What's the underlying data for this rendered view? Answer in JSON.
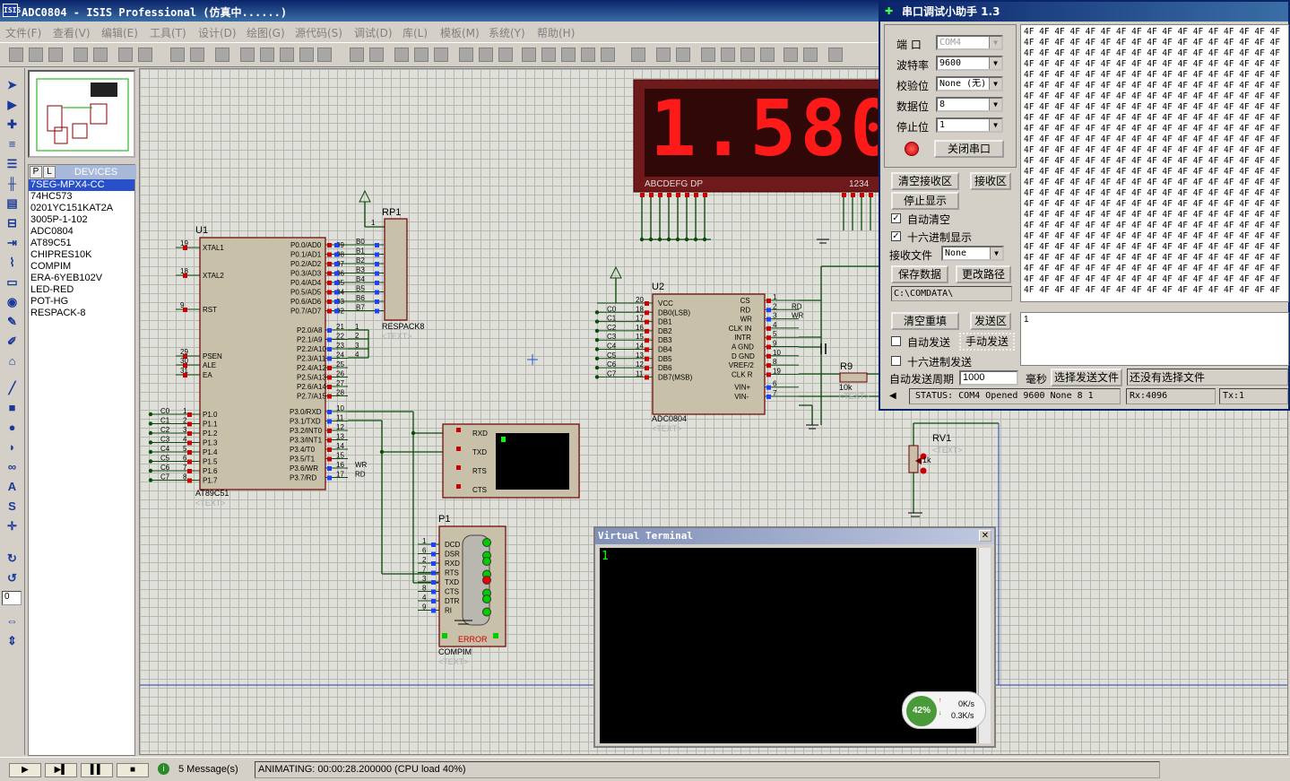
{
  "window": {
    "title": "ADC0804 - ISIS Professional (仿真中......)",
    "logo": "ISIS"
  },
  "menu": [
    "文件(F)",
    "查看(V)",
    "编辑(E)",
    "工具(T)",
    "设计(D)",
    "绘图(G)",
    "源代码(S)",
    "调试(D)",
    "库(L)",
    "模板(M)",
    "系统(Y)",
    "帮助(H)"
  ],
  "devices": {
    "tab_p": "P",
    "tab_l": "L",
    "header": "DEVICES",
    "items": [
      "7SEG-MPX4-CC",
      "74HC573",
      "0201YC151KAT2A",
      "3005P-1-102",
      "ADC0804",
      "AT89C51",
      "CHIPRES10K",
      "COMPIM",
      "ERA-6YEB102V",
      "LED-RED",
      "POT-HG",
      "RESPACK-8"
    ],
    "selected": "7SEG-MPX4-CC"
  },
  "rotation_value": "0",
  "schematic": {
    "u1": {
      "ref": "U1",
      "part": "AT89C51",
      "text": "<TEXT>"
    },
    "rp1": {
      "ref": "RP1",
      "part": "RESPACK8",
      "text": "<TEXT>"
    },
    "u2": {
      "ref": "U2",
      "part": "ADC0804",
      "text": "<TEXT>"
    },
    "p1": {
      "ref": "P1",
      "part": "COMPIM",
      "text": "<TEXT>",
      "error": "ERROR"
    },
    "r9": {
      "ref": "R9",
      "value": "10k",
      "text": "<TEXT>"
    },
    "rv1": {
      "ref": "RV1",
      "value": "1k",
      "text": "<TEXT>"
    },
    "display": {
      "digits": "1.580",
      "seg_label": "ABCDEFG  DP",
      "dig_label": "1234"
    },
    "u1_left_pins": [
      [
        "19",
        "XTAL1"
      ],
      [
        "18",
        "XTAL2"
      ],
      [
        "9",
        "RST"
      ],
      [
        "29",
        "PSEN"
      ],
      [
        "30",
        "ALE"
      ],
      [
        "31",
        "EA"
      ]
    ],
    "u1_port1": [
      [
        "1",
        "P1.0",
        "C0"
      ],
      [
        "2",
        "P1.1",
        "C1"
      ],
      [
        "3",
        "P1.2",
        "C2"
      ],
      [
        "4",
        "P1.3",
        "C3"
      ],
      [
        "5",
        "P1.4",
        "C4"
      ],
      [
        "6",
        "P1.5",
        "C5"
      ],
      [
        "7",
        "P1.6",
        "C6"
      ],
      [
        "8",
        "P1.7",
        "C7"
      ]
    ],
    "u1_port0": [
      [
        "39",
        "P0.0/AD0",
        "B0"
      ],
      [
        "38",
        "P0.1/AD1",
        "B1"
      ],
      [
        "37",
        "P0.2/AD2",
        "B2"
      ],
      [
        "36",
        "P0.3/AD3",
        "B3"
      ],
      [
        "35",
        "P0.4/AD4",
        "B4"
      ],
      [
        "34",
        "P0.5/AD5",
        "B5"
      ],
      [
        "33",
        "P0.6/AD6",
        "B6"
      ],
      [
        "32",
        "P0.7/AD7",
        "B7"
      ]
    ],
    "u1_port2": [
      [
        "21",
        "P2.0/A8"
      ],
      [
        "22",
        "P2.1/A9"
      ],
      [
        "23",
        "P2.2/A10"
      ],
      [
        "24",
        "P2.3/A11"
      ],
      [
        "25",
        "P2.4/A12"
      ],
      [
        "26",
        "P2.5/A13"
      ],
      [
        "27",
        "P2.6/A14"
      ],
      [
        "28",
        "P2.7/A15"
      ]
    ],
    "u1_port3": [
      [
        "10",
        "P3.0/RXD",
        ""
      ],
      [
        "11",
        "P3.1/TXD",
        ""
      ],
      [
        "12",
        "P3.2/INT0",
        ""
      ],
      [
        "13",
        "P3.3/INT1",
        ""
      ],
      [
        "14",
        "P3.4/T0",
        ""
      ],
      [
        "15",
        "P3.5/T1",
        ""
      ],
      [
        "16",
        "P3.6/WR",
        "WR"
      ],
      [
        "17",
        "P3.7/RD",
        "RD"
      ]
    ],
    "u2_left": [
      [
        "20",
        "VCC",
        ""
      ],
      [
        "18",
        "DB0(LSB)",
        "C0"
      ],
      [
        "17",
        "DB1",
        "C1"
      ],
      [
        "16",
        "DB2",
        "C2"
      ],
      [
        "15",
        "DB3",
        "C3"
      ],
      [
        "14",
        "DB4",
        "C4"
      ],
      [
        "13",
        "DB5",
        "C5"
      ],
      [
        "12",
        "DB6",
        "C6"
      ],
      [
        "11",
        "DB7(MSB)",
        "C7"
      ]
    ],
    "u2_right": [
      [
        "1",
        "CS",
        ""
      ],
      [
        "2",
        "RD",
        "RD"
      ],
      [
        "3",
        "WR",
        "WR"
      ],
      [
        "4",
        "CLK IN",
        ""
      ],
      [
        "5",
        "INTR",
        ""
      ],
      [
        "9",
        "A GND",
        ""
      ],
      [
        "10",
        "D GND",
        ""
      ],
      [
        "8",
        "VREF/2",
        ""
      ],
      [
        "19",
        "CLK R",
        ""
      ],
      [
        "6",
        "VIN+",
        ""
      ],
      [
        "7",
        "VIN-",
        ""
      ]
    ],
    "p1_pins": [
      [
        "1",
        "DCD"
      ],
      [
        "6",
        "DSR"
      ],
      [
        "2",
        "RXD"
      ],
      [
        "7",
        "RTS"
      ],
      [
        "3",
        "TXD"
      ],
      [
        "8",
        "CTS"
      ],
      [
        "4",
        "DTR"
      ],
      [
        "9",
        "RI"
      ]
    ],
    "vt_pins": [
      "RXD",
      "TXD",
      "RTS",
      "CTS"
    ]
  },
  "serial_tool": {
    "title": "串口调试小助手 1.3",
    "port_label": "端  口",
    "port": "COM4",
    "baud_label": "波特率",
    "baud": "9600",
    "parity_label": "校验位",
    "parity": "None (无)",
    "databits_label": "数据位",
    "databits": "8",
    "stopbits_label": "停止位",
    "stopbits": "1",
    "close_btn": "关闭串口",
    "clear_recv": "清空接收区",
    "recv_area": "接收区",
    "stop_display": "停止显示",
    "auto_clear": "自动清空",
    "hex_display": "十六进制显示",
    "recv_file_label": "接收文件",
    "recv_file": "None",
    "save_data": "保存数据",
    "change_path": "更改路径",
    "path": "C:\\COMDATA\\",
    "clear_resend": "清空重填",
    "send_area": "发送区",
    "auto_send": "自动发送",
    "manual_send": "手动发送",
    "hex_send": "十六进制发送",
    "send_text": "1",
    "period_label": "自动发送周期",
    "period": "1000",
    "ms": "毫秒",
    "choose_file": "选择发送文件",
    "no_file": "还没有选择文件",
    "status": "STATUS: COM4 Opened 9600 None 8 1",
    "rx": "Rx:4096",
    "tx": "Tx:1",
    "hex_token": "4F",
    "hex_rows": 25,
    "hex_cols": 17
  },
  "vterm": {
    "title": "Virtual Terminal",
    "content": "1"
  },
  "net": {
    "percent": "42%",
    "up": "0K/s",
    "down": "0.3K/s"
  },
  "status": {
    "messages": "5 Message(s)",
    "animating": "ANIMATING: 00:00:28.200000 (CPU load 40%)"
  }
}
